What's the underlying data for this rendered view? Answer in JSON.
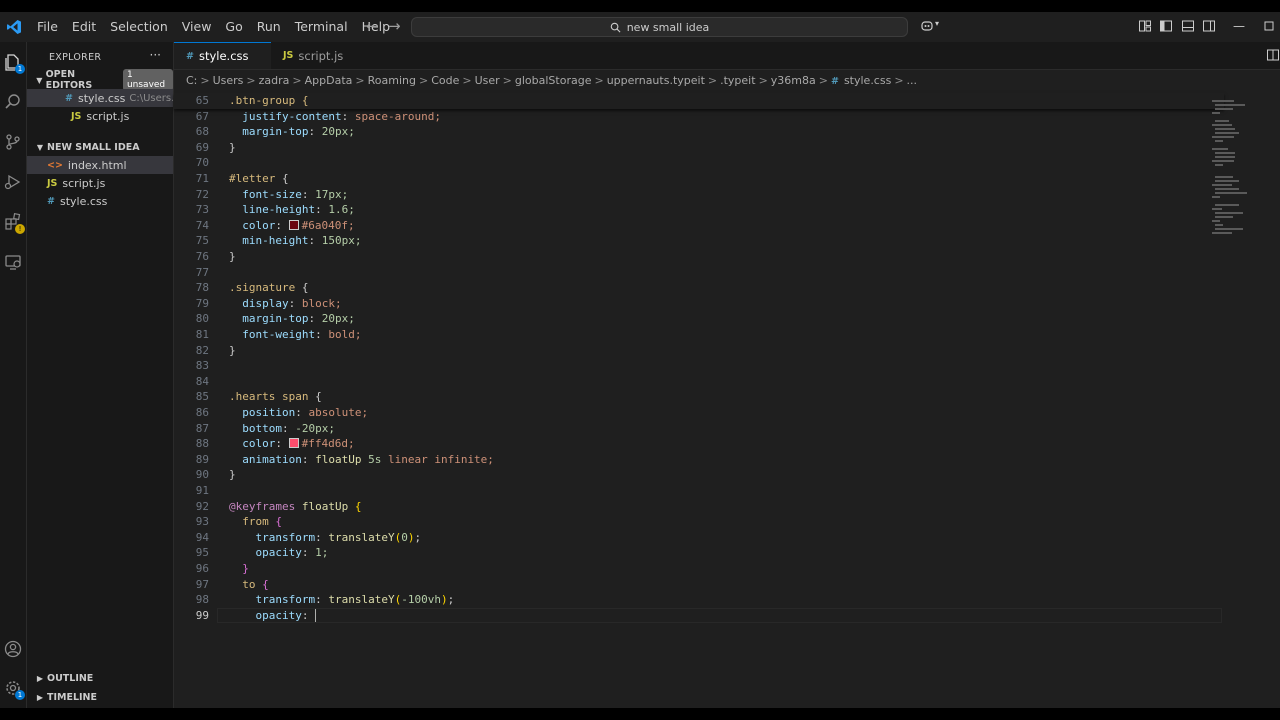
{
  "menu": [
    "File",
    "Edit",
    "Selection",
    "View",
    "Go",
    "Run",
    "Terminal",
    "Help"
  ],
  "command_center": {
    "text": "new small idea"
  },
  "explorer": {
    "title": "EXPLORER",
    "more": "···",
    "open_editors": {
      "label": "OPEN EDITORS",
      "badge": "1 unsaved",
      "items": [
        {
          "icon": "#",
          "name": "style.css",
          "path": "C:\\Users..."
        },
        {
          "icon": "JS",
          "name": "script.js"
        }
      ]
    },
    "folder": {
      "label": "NEW SMALL IDEA",
      "items": [
        {
          "icon": "<>",
          "name": "index.html"
        },
        {
          "icon": "JS",
          "name": "script.js"
        },
        {
          "icon": "#",
          "name": "style.css"
        }
      ]
    },
    "outline": "OUTLINE",
    "timeline": "TIMELINE"
  },
  "activity_badges": {
    "explorer": "1",
    "accounts_settings": "1"
  },
  "tabs": [
    {
      "icon": "#",
      "name": "style.css"
    },
    {
      "icon": "JS",
      "name": "script.js"
    }
  ],
  "breadcrumb": [
    "C:",
    "Users",
    "zadra",
    "AppData",
    "Roaming",
    "Code",
    "User",
    "globalStorage",
    "uppernauts.typeit",
    ".typeit",
    "y36m8a",
    "style.css",
    "..."
  ],
  "breadcrumb_file_icon": "#",
  "code": {
    "sticky": {
      "n": "65",
      "text": ".btn-group {"
    },
    "lines": [
      {
        "n": "67",
        "ind": "  ",
        "prop": "justify-content",
        "val": "space-around;"
      },
      {
        "n": "68",
        "ind": "  ",
        "prop": "margin-top",
        "num": "20px;"
      },
      {
        "n": "69",
        "close": "}"
      },
      {
        "n": "70"
      },
      {
        "n": "71",
        "sel": "#letter",
        "open": " {"
      },
      {
        "n": "72",
        "ind": "  ",
        "prop": "font-size",
        "num": "17px;"
      },
      {
        "n": "73",
        "ind": "  ",
        "prop": "line-height",
        "num": "1.6;"
      },
      {
        "n": "74",
        "ind": "  ",
        "prop": "color",
        "swatch": "#6a040f",
        "val": "#6a040f;"
      },
      {
        "n": "75",
        "ind": "  ",
        "prop": "min-height",
        "num": "150px;"
      },
      {
        "n": "76",
        "close": "}"
      },
      {
        "n": "77"
      },
      {
        "n": "78",
        "sel": ".signature",
        "open": " {"
      },
      {
        "n": "79",
        "ind": "  ",
        "prop": "display",
        "val": "block;"
      },
      {
        "n": "80",
        "ind": "  ",
        "prop": "margin-top",
        "num": "20px;"
      },
      {
        "n": "81",
        "ind": "  ",
        "prop": "font-weight",
        "val": "bold;"
      },
      {
        "n": "82",
        "close": "}"
      },
      {
        "n": "83"
      },
      {
        "n": "84"
      },
      {
        "n": "85",
        "sel": ".hearts span",
        "open": " {"
      },
      {
        "n": "86",
        "ind": "  ",
        "prop": "position",
        "val": "absolute;"
      },
      {
        "n": "87",
        "ind": "  ",
        "prop": "bottom",
        "num": "-20px;"
      },
      {
        "n": "88",
        "ind": "  ",
        "prop": "color",
        "swatch": "#ff4d6d",
        "val": "#ff4d6d;"
      },
      {
        "n": "89",
        "ind": "  ",
        "prop": "animation",
        "anim": [
          "floatUp",
          "5s",
          "linear infinite;"
        ]
      },
      {
        "n": "90",
        "close": "}"
      },
      {
        "n": "91"
      },
      {
        "n": "92",
        "at": "@keyframes",
        "name": " floatUp ",
        "brace": "{"
      },
      {
        "n": "93",
        "ind": "  ",
        "kf": "from",
        "brace": " {"
      },
      {
        "n": "94",
        "ind": "    ",
        "prop": "transform",
        "fn": "translateY",
        "arg": "0",
        "tail": ";"
      },
      {
        "n": "95",
        "ind": "    ",
        "prop": "opacity",
        "num": "1;"
      },
      {
        "n": "96",
        "ind": "  ",
        "close2": "}"
      },
      {
        "n": "97",
        "ind": "  ",
        "kf": "to",
        "brace": " {"
      },
      {
        "n": "98",
        "ind": "    ",
        "prop": "transform",
        "fn": "translateY",
        "arg": "-100vh",
        "tail": ";"
      },
      {
        "n": "99",
        "ind": "    ",
        "prop": "opacity",
        "cursor": true,
        "current": true
      }
    ]
  }
}
